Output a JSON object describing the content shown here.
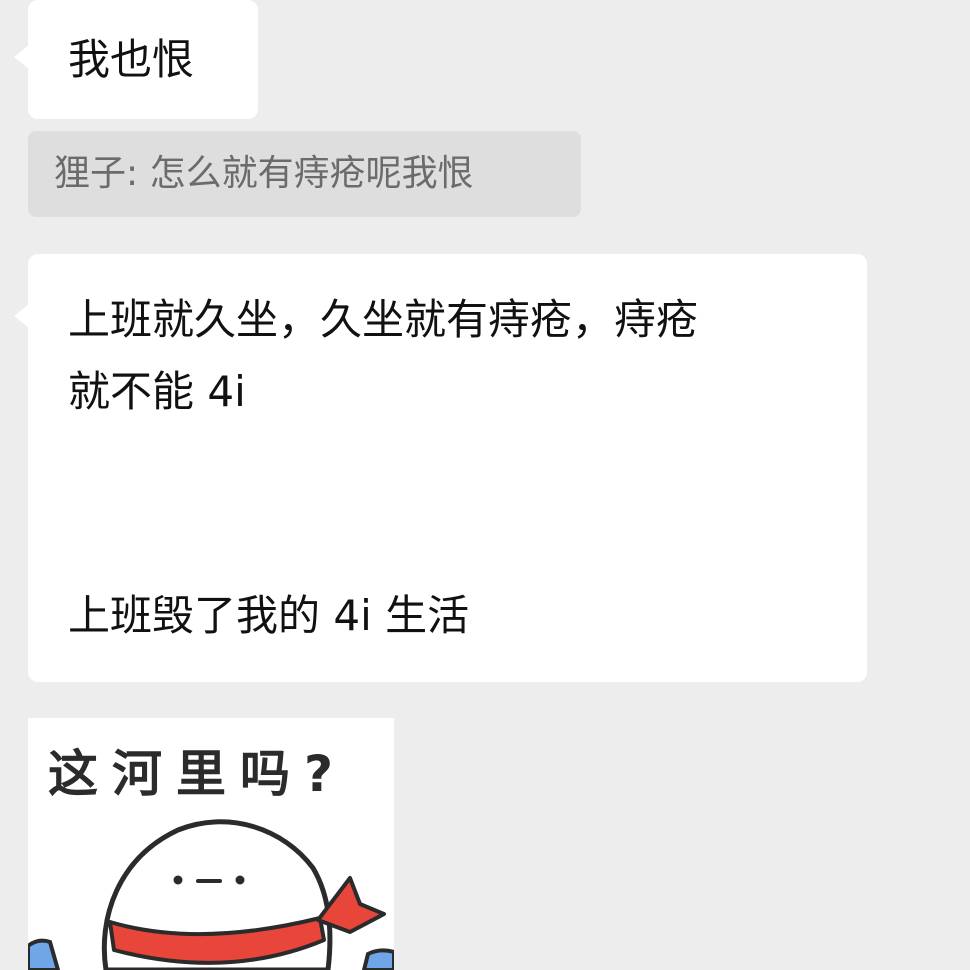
{
  "messages": {
    "msg1": {
      "text": "我也恨"
    },
    "quote": {
      "text": "狸子: 怎么就有痔疮呢我恨"
    },
    "msg2": {
      "line1": "上班就久坐，久坐就有痔疮，痔疮",
      "line2": "就不能 4i",
      "line3": "上班毁了我的 4i 生活"
    },
    "sticker": {
      "caption": "这河里吗?",
      "icon": "blob-character-with-red-scarf-icon"
    }
  },
  "colors": {
    "background": "#ededed",
    "bubble": "#ffffff",
    "quote_bg": "#dedede",
    "quote_text": "#6b6b6b",
    "scarf": "#e8463a",
    "sleeve": "#6fa6e8"
  }
}
